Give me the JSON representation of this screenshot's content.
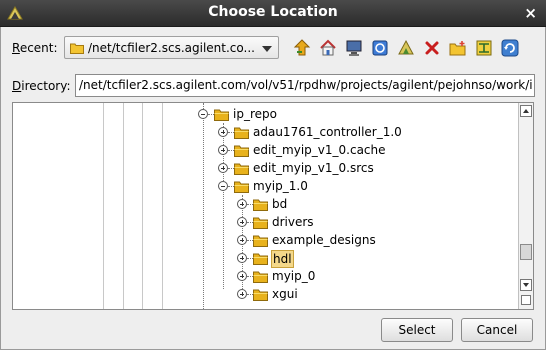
{
  "window": {
    "title": "Choose Location",
    "close_glyph": "×"
  },
  "recent": {
    "label_prefix": "",
    "label_mnemonic": "R",
    "label_rest": "ecent:",
    "value": "/net/tcfiler2.scs.agilent.co..."
  },
  "toolbar": {
    "buttons": [
      {
        "name": "up-folder-icon"
      },
      {
        "name": "home-icon"
      },
      {
        "name": "desktop-icon"
      },
      {
        "name": "project-icon"
      },
      {
        "name": "network-icon"
      },
      {
        "name": "delete-icon"
      },
      {
        "name": "new-folder-icon"
      },
      {
        "name": "view-toggle-icon"
      },
      {
        "name": "refresh-icon"
      }
    ]
  },
  "directory": {
    "label_mnemonic": "D",
    "label_rest": "irectory:",
    "value": "/net/tcfiler2.scs.agilent.com/vol/v51/rpdhw/projects/agilent/pejohnso/work/i"
  },
  "tree": {
    "items": [
      {
        "label": "ip_repo",
        "state": "expanded"
      },
      {
        "label": "adau1761_controller_1.0",
        "state": "collapsed"
      },
      {
        "label": "edit_myip_v1_0.cache",
        "state": "collapsed"
      },
      {
        "label": "edit_myip_v1_0.srcs",
        "state": "collapsed"
      },
      {
        "label": "myip_1.0",
        "state": "expanded"
      },
      {
        "label": "bd",
        "state": "collapsed"
      },
      {
        "label": "drivers",
        "state": "collapsed"
      },
      {
        "label": "example_designs",
        "state": "collapsed"
      },
      {
        "label": "hdl",
        "state": "collapsed",
        "selected": true
      },
      {
        "label": "myip_0",
        "state": "collapsed"
      },
      {
        "label": "xgui",
        "state": "collapsed"
      }
    ]
  },
  "buttons": {
    "select_label": "Select",
    "cancel_label": "Cancel"
  },
  "colors": {
    "titlebar": "#2b2b2b",
    "folder": "#e8b21c",
    "selection": "#f4d88a"
  }
}
